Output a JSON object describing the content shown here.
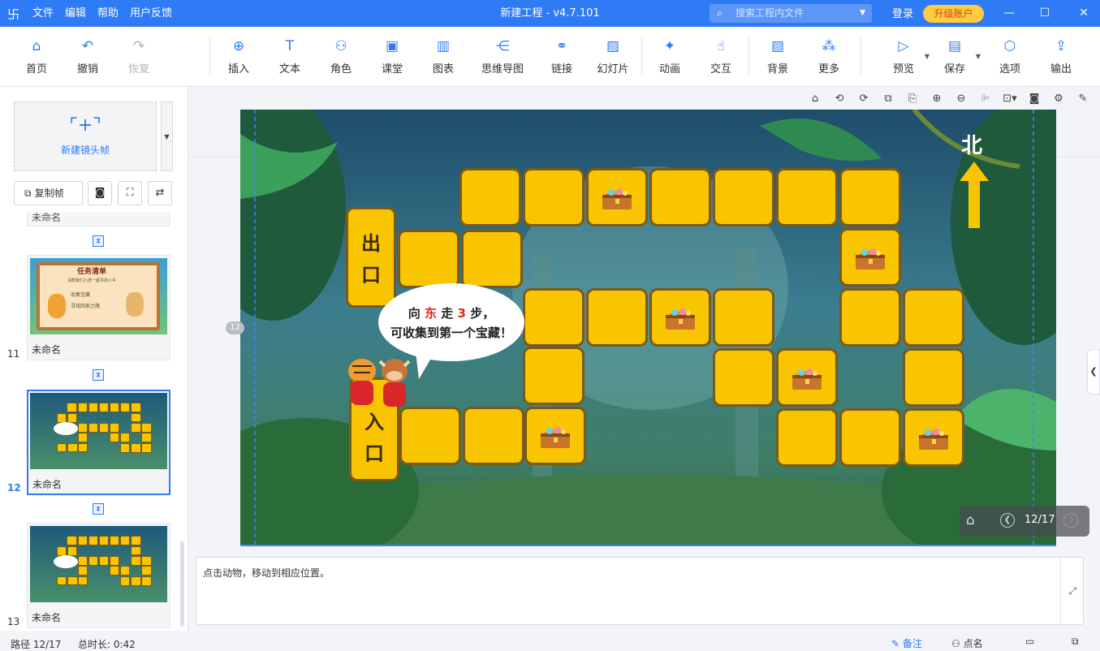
{
  "window": {
    "title": "新建工程 - v4.7.101",
    "logo_icon": "app-logo-icon"
  },
  "menu": [
    "文件",
    "编辑",
    "帮助",
    "用户反馈"
  ],
  "search": {
    "placeholder": "搜索工程内文件"
  },
  "account": {
    "login": "登录",
    "upgrade": "升级账户"
  },
  "toolbar": {
    "home": "首页",
    "undo": "撤销",
    "redo": "恢复",
    "insert": "插入",
    "text": "文本",
    "role": "角色",
    "classroom": "课堂",
    "chart": "图表",
    "mindmap": "思维导图",
    "link": "链接",
    "slideshow": "幻灯片",
    "animation": "动画",
    "interaction": "交互",
    "background": "背景",
    "more": "更多",
    "preview": "预览",
    "save": "保存",
    "options": "选项",
    "export": "输出"
  },
  "sidebar": {
    "new_frame": "新建镜头帧",
    "copy_frame": "复制帧",
    "top_partial_label": "未命名",
    "frames": [
      {
        "number": "11",
        "label": "未命名",
        "selected": false
      },
      {
        "number": "12",
        "label": "未命名",
        "selected": true
      },
      {
        "number": "13",
        "label": "未命名",
        "selected": false
      }
    ],
    "thumb11": {
      "title": "任务清单",
      "line1": "请帮我们小虎一起寻找小牛",
      "line2": "收集宝藏",
      "line3": "寻找回家之路"
    }
  },
  "stage": {
    "exit_label": [
      "出",
      "口"
    ],
    "entrance_label": [
      "入",
      "口"
    ],
    "north": "北",
    "bubble": {
      "pre": "向",
      "dir": "东",
      "mid": "走",
      "num": "3",
      "post": "步，",
      "line2": "可收集到第一个宝藏！"
    },
    "accent_red": "#e8241d",
    "tile_color": "#f9c500"
  },
  "frame_badge": "12",
  "nav": {
    "page": "12/17"
  },
  "notes": {
    "text": "点击动物，移动到相应位置。"
  },
  "status": {
    "path": "路径 12/17",
    "duration": "总时长: 0:42",
    "notes_btn": "备注",
    "rollcall": "点名"
  }
}
